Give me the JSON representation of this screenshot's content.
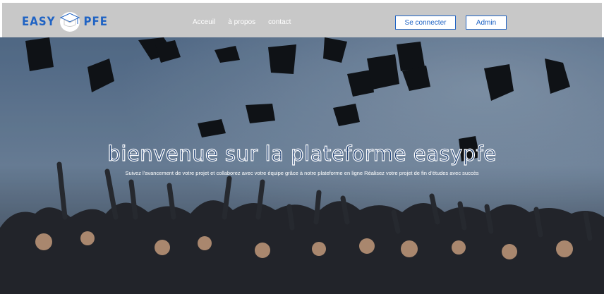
{
  "brand": {
    "left": "EASY",
    "right": "PFE",
    "color": "#1f63c4"
  },
  "nav": {
    "links": [
      "Acceuil",
      "à propos",
      "contact"
    ]
  },
  "auth": {
    "login_label": "Se connecter",
    "admin_label": "Admin"
  },
  "hero": {
    "title": "bienvenue sur la plateforme easypfe",
    "subtitle": "Suivez l'avancement de votre projet et collaborez avec votre équipe grâce à notre plateforme en ligne Réalisez votre projet de fin d'études avec succès"
  },
  "colors": {
    "navbar": "#c8c8c8",
    "accent": "#1f63c4",
    "sky": "#5d7896"
  }
}
